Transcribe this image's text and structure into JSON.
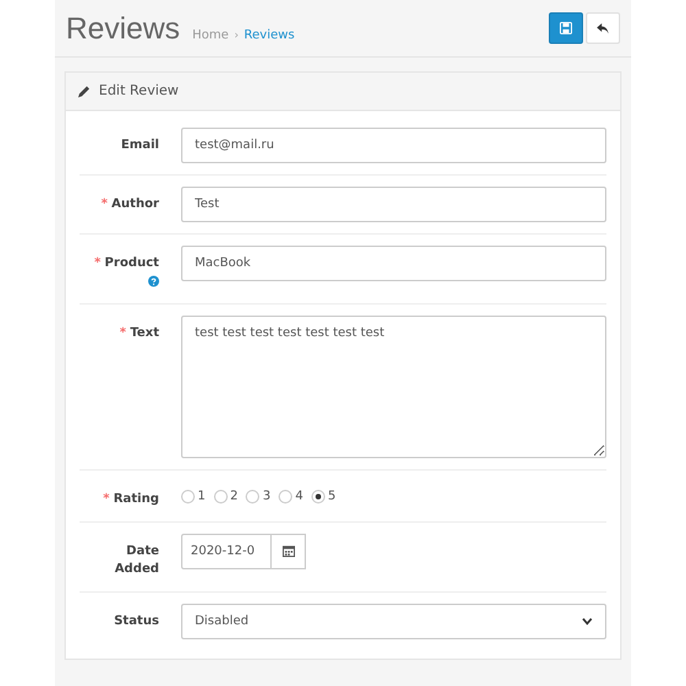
{
  "header": {
    "title": "Reviews",
    "separator": "›",
    "breadcrumb": [
      {
        "label": "Home",
        "selected": false
      },
      {
        "label": "Reviews",
        "selected": true
      }
    ]
  },
  "panel": {
    "title": "Edit Review"
  },
  "fields": [
    {
      "kind": "text",
      "label": "Email",
      "help": false,
      "value": "test@mail.ru"
    },
    {
      "kind": "text",
      "label": "Author",
      "required_mark": "*",
      "help": false,
      "value": "Test"
    },
    {
      "kind": "text",
      "label": "Product",
      "required_mark": "*",
      "help": true,
      "value": "MacBook"
    },
    {
      "kind": "textarea",
      "label": "Text",
      "required_mark": "*",
      "help": false,
      "value": "test test test test test test test"
    },
    {
      "kind": "radio",
      "label": "Rating",
      "required_mark": "*",
      "help": false,
      "options": [
        {
          "label": "1",
          "selected": false
        },
        {
          "label": "2",
          "selected": false
        },
        {
          "label": "3",
          "selected": false
        },
        {
          "label": "4",
          "selected": false
        },
        {
          "label": "5",
          "selected": true
        }
      ]
    },
    {
      "kind": "date",
      "label": "Date Added",
      "help": false,
      "value": "2020-12-0"
    },
    {
      "kind": "select",
      "label": "Status",
      "help": false,
      "value": "Disabled"
    }
  ]
}
